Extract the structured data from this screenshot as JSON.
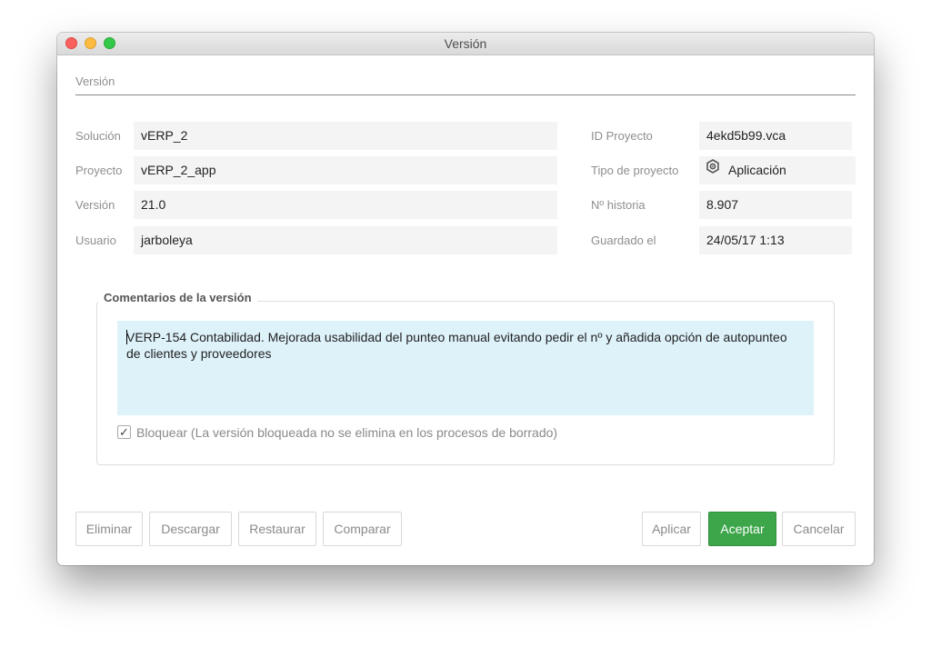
{
  "window": {
    "title": "Versión"
  },
  "section": {
    "title": "Versión"
  },
  "fields": {
    "solucion": {
      "label": "Solución",
      "value": "vERP_2"
    },
    "proyecto": {
      "label": "Proyecto",
      "value": "vERP_2_app"
    },
    "version": {
      "label": "Versión",
      "value": "21.0"
    },
    "usuario": {
      "label": "Usuario",
      "value": "jarboleya"
    },
    "id_proyecto": {
      "label": "ID Proyecto",
      "value": "4ekd5b99.vca"
    },
    "tipo_proyecto": {
      "label": "Tipo de proyecto",
      "value": "Aplicación",
      "icon": "hexagon-gear-icon"
    },
    "n_historia": {
      "label": "Nº historia",
      "value": "8.907"
    },
    "guardado": {
      "label": "Guardado el",
      "value": "24/05/17 1:13"
    }
  },
  "comments": {
    "title": "Comentarios de la versión",
    "text": "VERP-154 Contabilidad. Mejorada usabilidad del punteo manual evitando pedir el nº y añadida opción de autopunteo de clientes y proveedores",
    "lock_label": "Bloquear (La versión bloqueada no se elimina en los procesos de borrado)",
    "lock_checked": true
  },
  "buttons": {
    "eliminar": "Eliminar",
    "descargar": "Descargar",
    "restaurar": "Restaurar",
    "comparar": "Comparar",
    "aplicar": "Aplicar",
    "aceptar": "Aceptar",
    "cancelar": "Cancelar"
  },
  "colors": {
    "accent": "#3da64a",
    "comment_bg": "#def2fa",
    "field_bg": "#f4f4f4"
  }
}
